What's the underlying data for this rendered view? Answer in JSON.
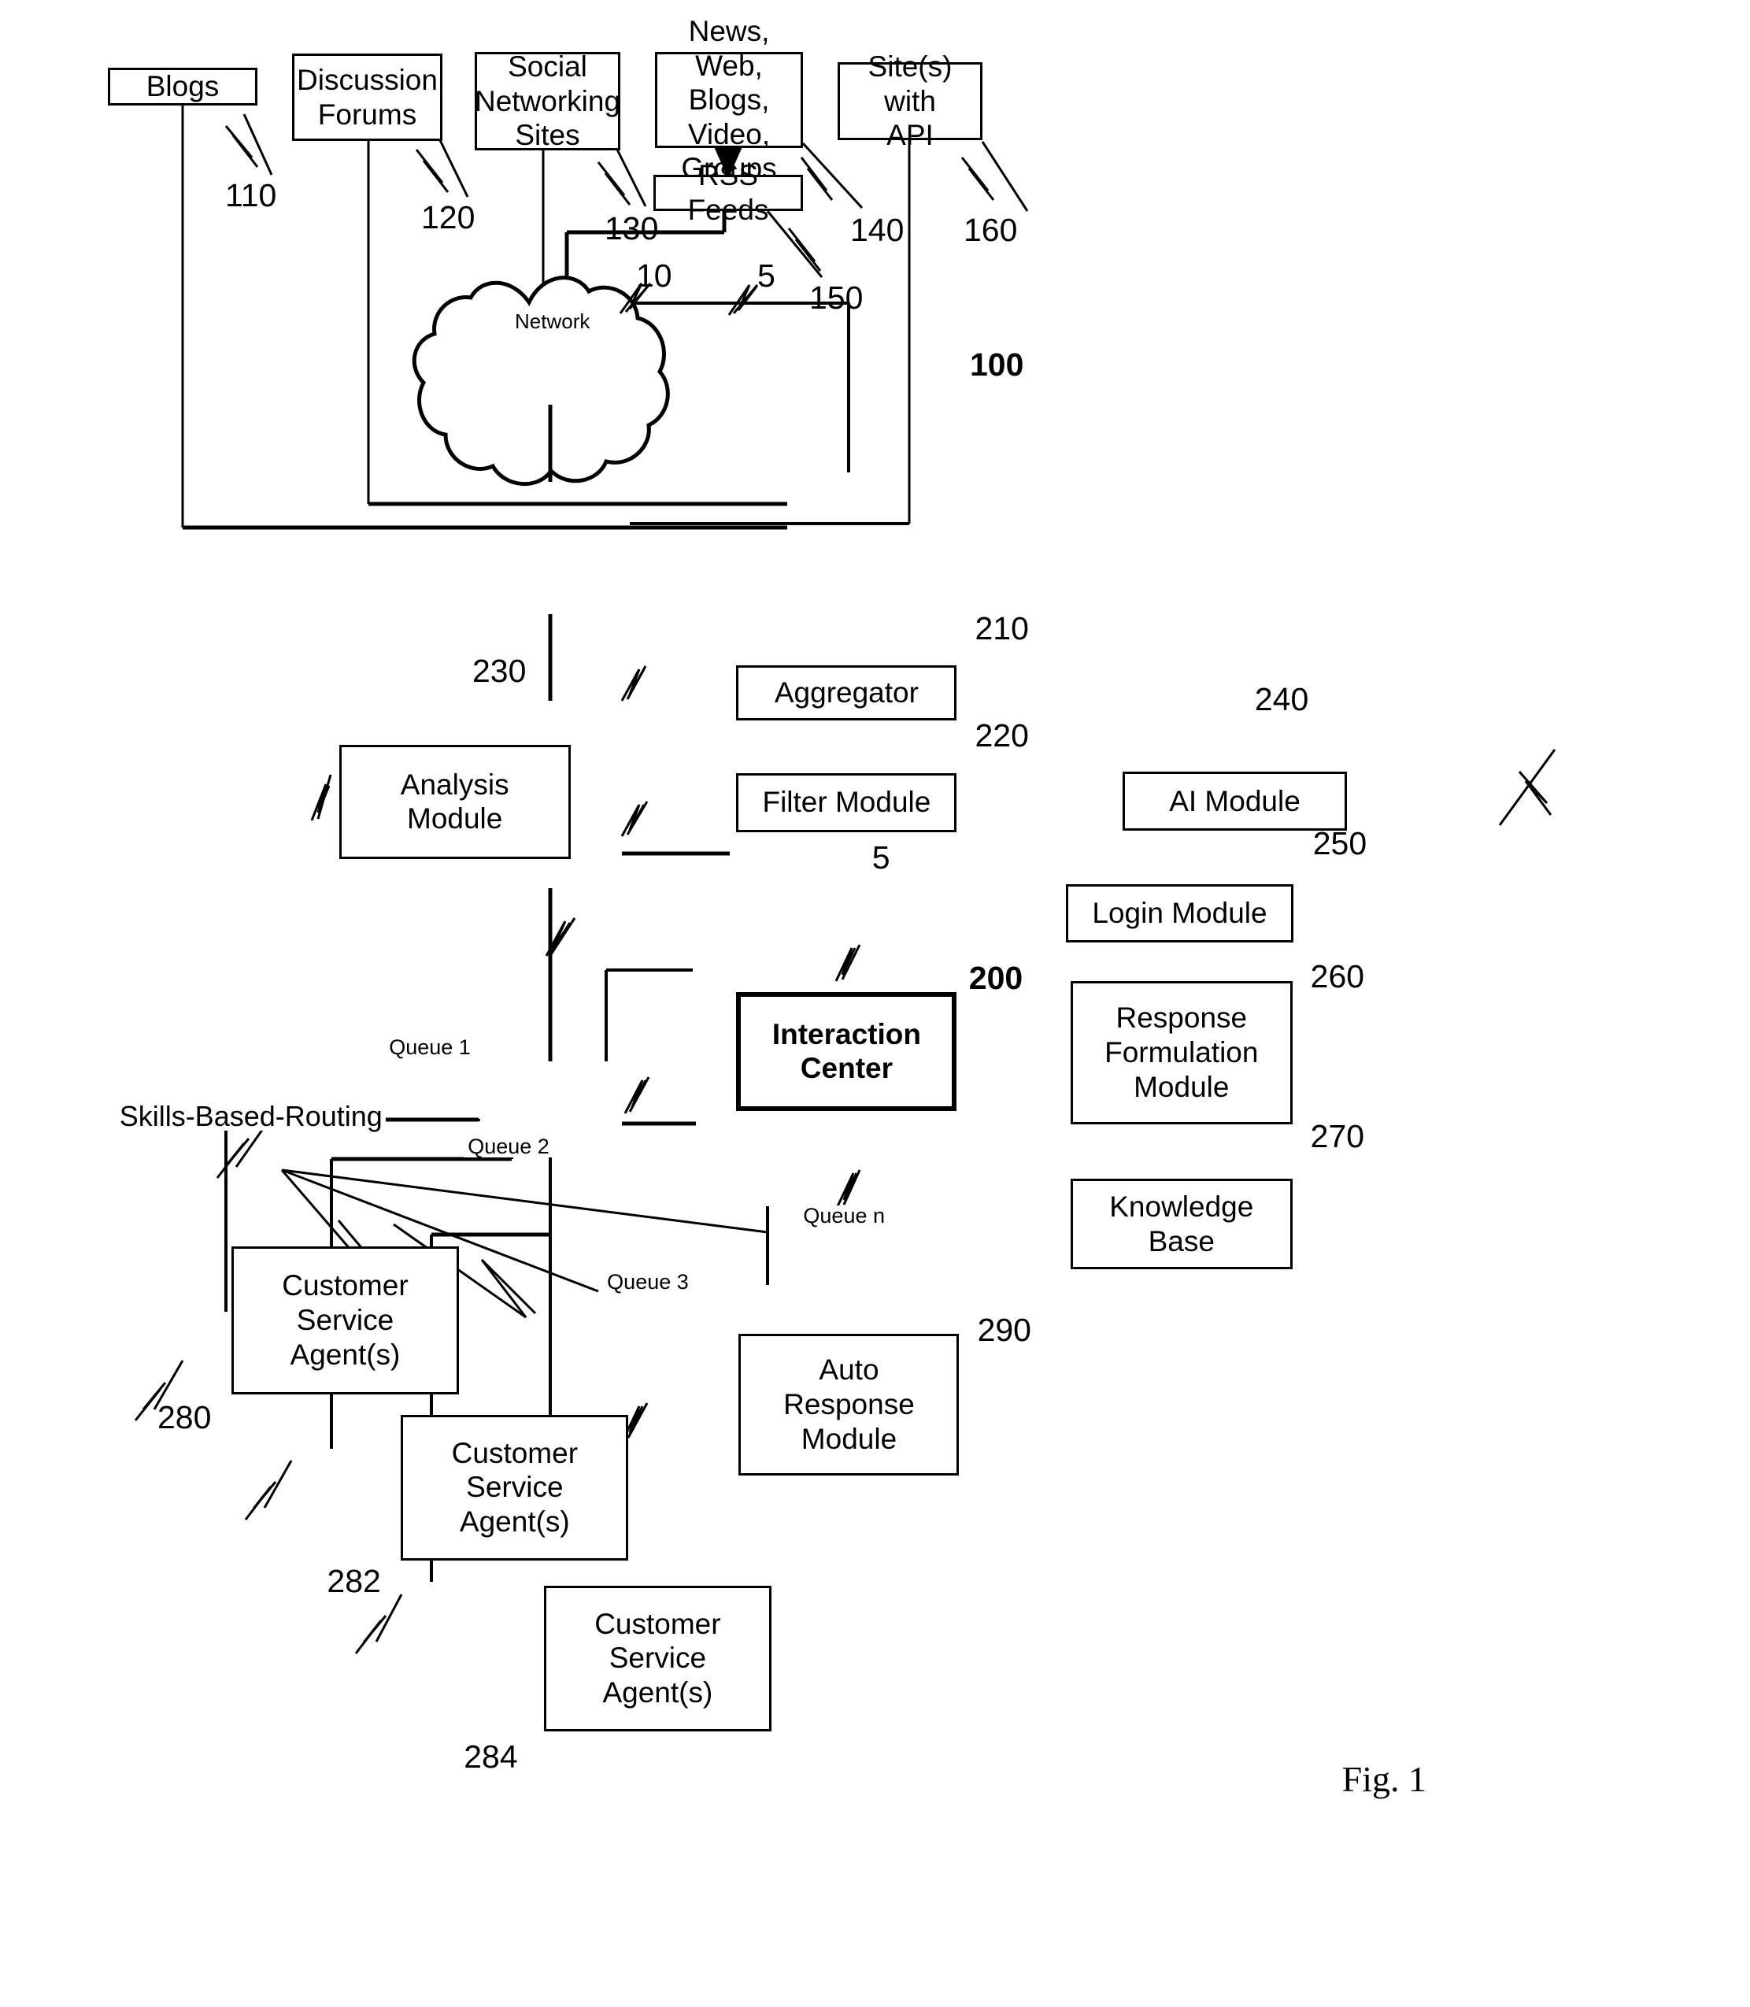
{
  "figure": {
    "caption": "Fig. 1",
    "system_ref": "100"
  },
  "sources": [
    {
      "id": "blogs",
      "label": "Blogs",
      "ref": "110"
    },
    {
      "id": "forums",
      "label": "Discussion\nForums",
      "ref": "120"
    },
    {
      "id": "social",
      "label": "Social\nNetworking\nSites",
      "ref": "130"
    },
    {
      "id": "news",
      "label": "News, Web,\nBlogs, Video,\nGroups",
      "ref": "140"
    },
    {
      "id": "api_sites",
      "label": "Site(s) with\nAPI",
      "ref": "160"
    },
    {
      "id": "rss",
      "label": "RSS Feeds",
      "ref": "150"
    }
  ],
  "network": {
    "label": "Network",
    "ref_left": "10",
    "ref_right": "5"
  },
  "pipeline": [
    {
      "id": "aggregator",
      "label": "Aggregator",
      "ref": "210"
    },
    {
      "id": "filter",
      "label": "Filter Module",
      "ref": "220"
    },
    {
      "id": "analysis",
      "label": "Analysis\nModule",
      "ref": "230"
    },
    {
      "id": "ai",
      "label": "AI Module",
      "ref": "240"
    },
    {
      "id": "login",
      "label": "Login Module",
      "ref": "250"
    },
    {
      "id": "interaction",
      "label": "Interaction\nCenter",
      "ref": "200"
    },
    {
      "id": "response",
      "label": "Response\nFormulation\nModule",
      "ref": "260"
    },
    {
      "id": "knowledge",
      "label": "Knowledge\nBase",
      "ref": "270"
    },
    {
      "id": "auto",
      "label": "Auto\nResponse\nModule",
      "ref": "290"
    }
  ],
  "link_ref_filter_to_ic": "5",
  "routing": {
    "label": "Skills-Based-Routing",
    "queues": [
      {
        "label": "Queue 1"
      },
      {
        "label": "Queue 2"
      },
      {
        "label": "Queue 3"
      },
      {
        "label": "Queue n"
      }
    ]
  },
  "agents": [
    {
      "id": "agent1",
      "label": "Customer\nService\nAgent(s)",
      "ref": "280"
    },
    {
      "id": "agent2",
      "label": "Customer\nService\nAgent(s)",
      "ref": "282"
    },
    {
      "id": "agent3",
      "label": "Customer\nService\nAgent(s)",
      "ref": "284"
    }
  ],
  "colors": {
    "ink": "#000000",
    "paper": "#ffffff"
  }
}
